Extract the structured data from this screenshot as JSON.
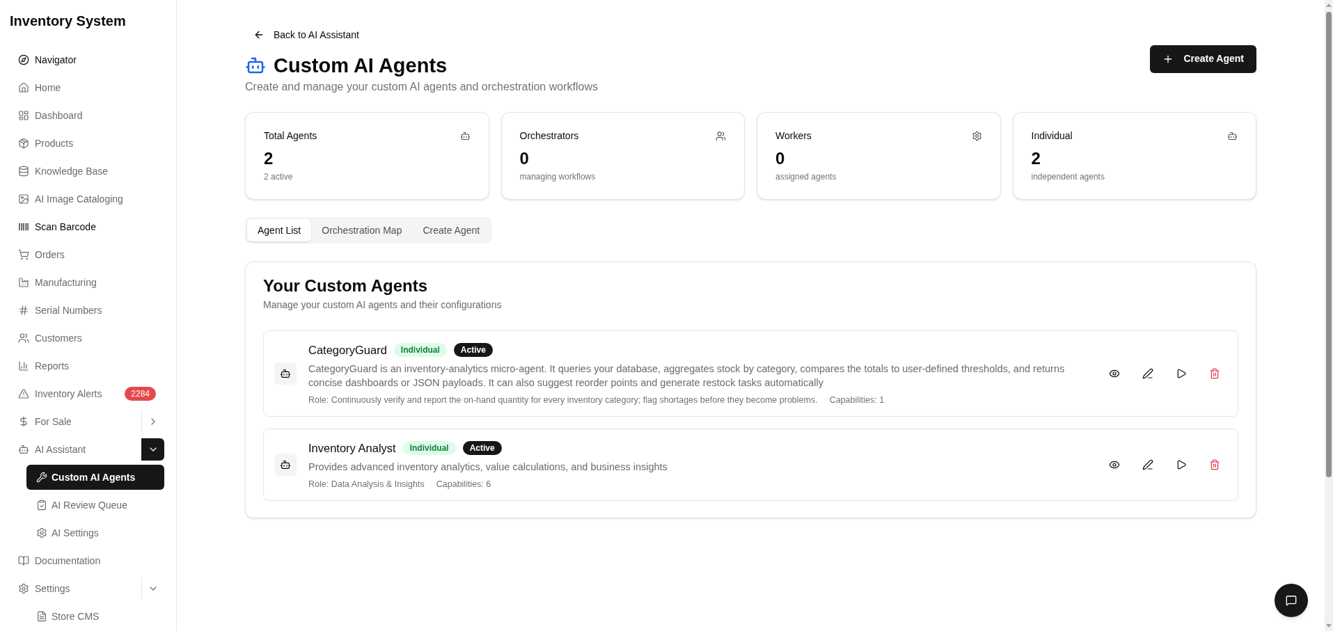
{
  "sidebar": {
    "title": "Inventory System",
    "items": [
      {
        "label": "Navigator",
        "selected": false,
        "emphasized": true
      },
      {
        "label": "Home",
        "selected": false,
        "emphasized": false
      },
      {
        "label": "Dashboard",
        "selected": false,
        "emphasized": false
      },
      {
        "label": "Products",
        "selected": false,
        "emphasized": false
      },
      {
        "label": "Knowledge Base",
        "selected": false,
        "emphasized": false
      },
      {
        "label": "AI Image Cataloging",
        "selected": false,
        "emphasized": false
      },
      {
        "label": "Scan Barcode",
        "selected": false,
        "emphasized": true
      },
      {
        "label": "Orders",
        "selected": false,
        "emphasized": false
      },
      {
        "label": "Manufacturing",
        "selected": false,
        "emphasized": false
      },
      {
        "label": "Serial Numbers",
        "selected": false,
        "emphasized": false
      },
      {
        "label": "Customers",
        "selected": false,
        "emphasized": false
      },
      {
        "label": "Reports",
        "selected": false,
        "emphasized": false
      },
      {
        "label": "Inventory Alerts",
        "selected": false,
        "emphasized": false,
        "badge": "2284"
      },
      {
        "label": "For Sale",
        "selected": false,
        "emphasized": false,
        "expanded": false
      },
      {
        "label": "AI Assistant",
        "selected": false,
        "emphasized": false,
        "expanded": true,
        "children": [
          {
            "label": "Custom AI Agents",
            "selected": true,
            "emphasized": false
          },
          {
            "label": "AI Review Queue",
            "selected": false,
            "emphasized": false
          },
          {
            "label": "AI Settings",
            "selected": false,
            "emphasized": false
          }
        ]
      },
      {
        "label": "Documentation",
        "selected": false,
        "emphasized": false
      },
      {
        "label": "Settings",
        "selected": false,
        "emphasized": false,
        "expanded": true,
        "children": [
          {
            "label": "Store CMS",
            "selected": false,
            "emphasized": false
          }
        ]
      }
    ]
  },
  "header": {
    "back_link": "Back to AI Assistant",
    "title": "Custom AI Agents",
    "subtitle": "Create and manage your custom AI agents and orchestration workflows",
    "create_button": "Create Agent"
  },
  "stats": [
    {
      "label": "Total Agents",
      "value": "2",
      "caption": "2 active"
    },
    {
      "label": "Orchestrators",
      "value": "0",
      "caption": "managing workflows"
    },
    {
      "label": "Workers",
      "value": "0",
      "caption": "assigned agents"
    },
    {
      "label": "Individual",
      "value": "2",
      "caption": "independent agents"
    }
  ],
  "tabs": [
    {
      "label": "Agent List",
      "selected": true
    },
    {
      "label": "Orchestration Map",
      "selected": false
    },
    {
      "label": "Create Agent",
      "selected": false
    }
  ],
  "agents_panel": {
    "title": "Your Custom Agents",
    "subtitle": "Manage your custom AI agents and their configurations",
    "agents": [
      {
        "name": "CategoryGuard",
        "type": {
          "label": "Individual",
          "kind": "individual"
        },
        "status": {
          "label": "Active",
          "active": true
        },
        "description": "CategoryGuard is an inventory-analytics micro-agent. It queries your database, aggregates stock by category, compares the totals to user-defined thresholds, and returns concise dashboards or JSON payloads. It can also suggest reorder points and generate restock tasks automatically",
        "role": "Role: Continuously verify and report the on-hand quantity for every inventory category; flag shortages before they become problems.",
        "capabilities": "Capabilities: 1"
      },
      {
        "name": "Inventory Analyst",
        "type": {
          "label": "Individual",
          "kind": "individual"
        },
        "status": {
          "label": "Active",
          "active": true
        },
        "description": "Provides advanced inventory analytics, value calculations, and business insights",
        "role": "Role: Data Analysis & Insights",
        "capabilities": "Capabilities: 6"
      }
    ]
  }
}
